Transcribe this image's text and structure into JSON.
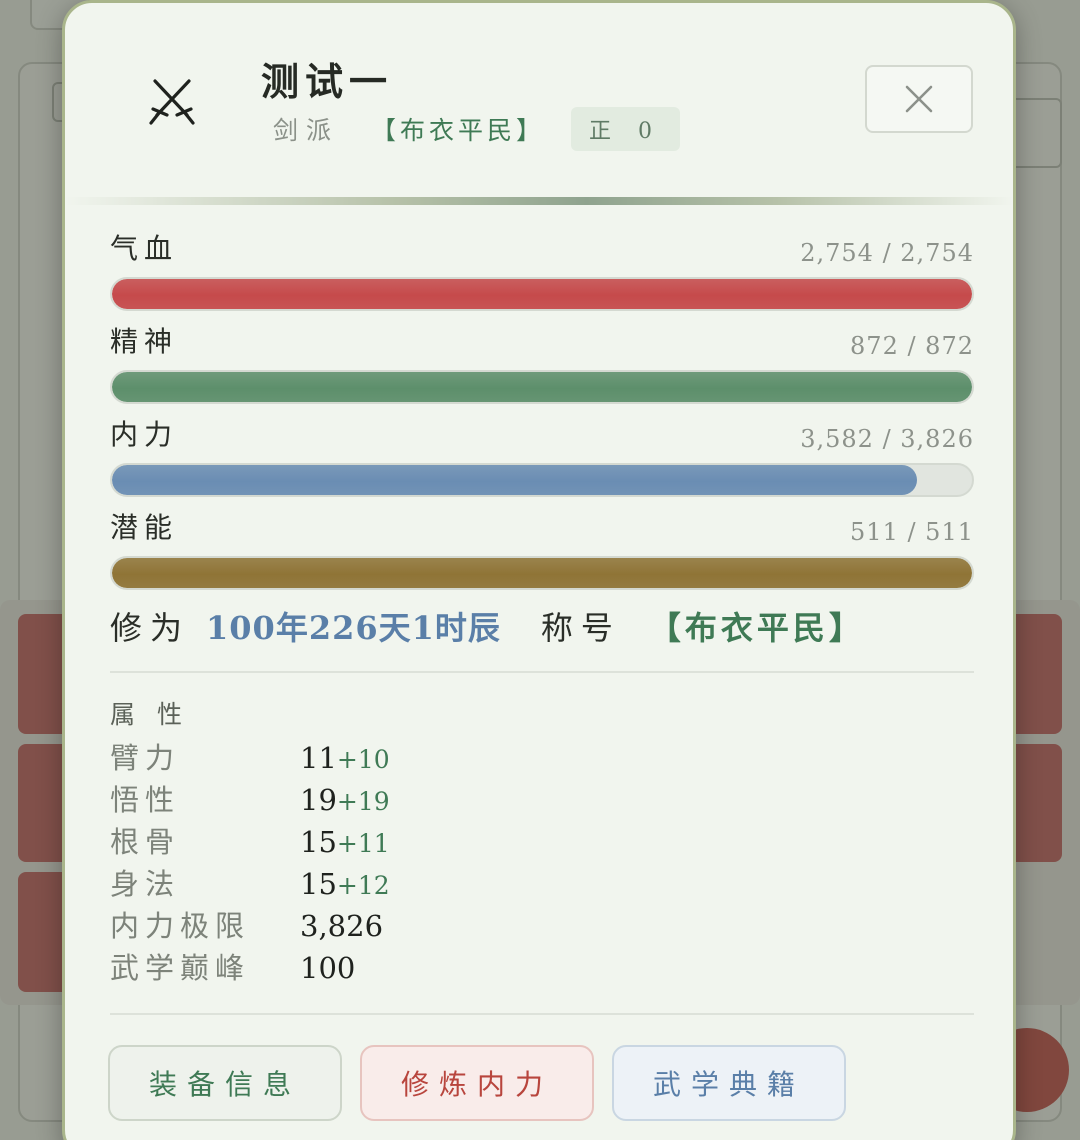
{
  "character": {
    "name": "测试一",
    "sect": "剑派",
    "rank_title": "【布衣平民】",
    "alignment": "正 0"
  },
  "stats": [
    {
      "label": "气血",
      "value": "2,754 / 2,754",
      "fraction": 1.0,
      "color": "#c64a4b"
    },
    {
      "label": "精神",
      "value": "872 / 872",
      "fraction": 1.0,
      "color": "#5d8f6b"
    },
    {
      "label": "内力",
      "value": "3,582 / 3,826",
      "fraction": 0.936,
      "color": "#6a8db3"
    },
    {
      "label": "潜能",
      "value": "511 / 511",
      "fraction": 1.0,
      "color": "#8f7436"
    }
  ],
  "cultivation": {
    "label": "修为",
    "value": "100年226天1时辰",
    "title_label": "称号",
    "title_value": "【布衣平民】"
  },
  "attributes": {
    "heading": "属性",
    "items": [
      {
        "name": "臂力",
        "base": "11",
        "bonus": "+10"
      },
      {
        "name": "悟性",
        "base": "19",
        "bonus": "+19"
      },
      {
        "name": "根骨",
        "base": "15",
        "bonus": "+11"
      },
      {
        "name": "身法",
        "base": "15",
        "bonus": "+12"
      },
      {
        "name": "内力极限",
        "base": "3,826",
        "bonus": ""
      },
      {
        "name": "武学巅峰",
        "base": "100",
        "bonus": ""
      }
    ]
  },
  "buttons": {
    "equip": "装备信息",
    "train": "修炼内力",
    "books": "武学典籍"
  },
  "icons": {
    "avatar": "crossed-swords-icon",
    "close": "close-icon"
  }
}
